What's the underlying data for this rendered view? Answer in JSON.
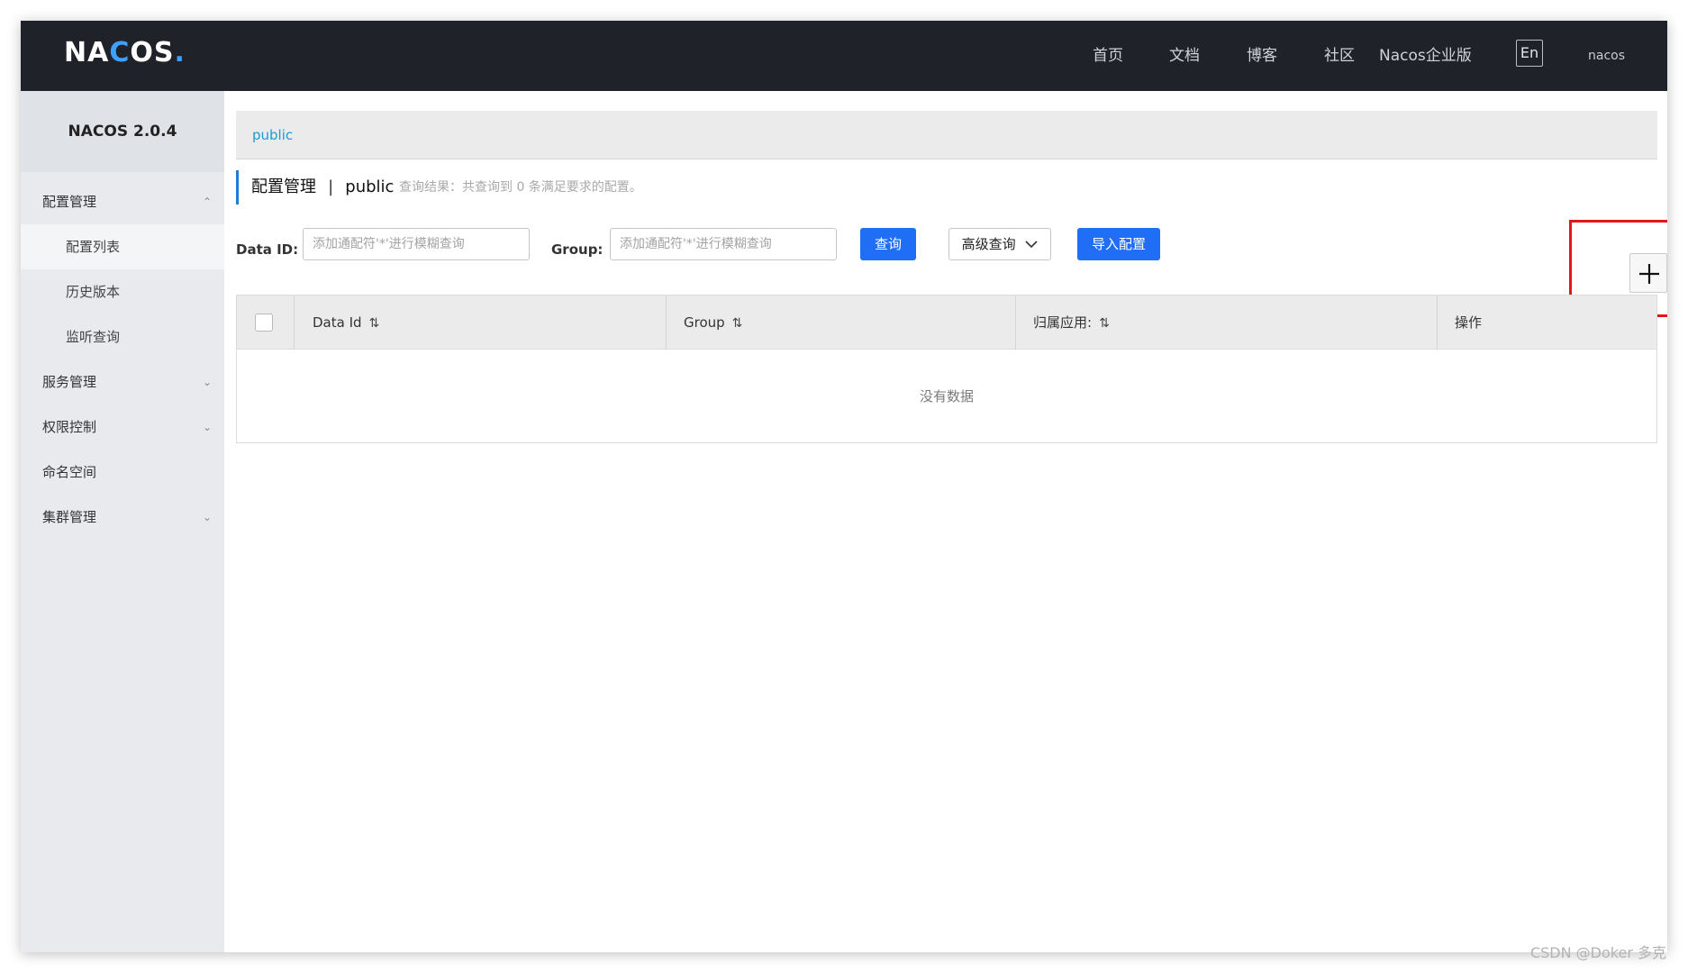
{
  "header": {
    "logo_text": "NACOS.",
    "nav": [
      "首页",
      "文档",
      "博客",
      "社区",
      "Nacos企业版"
    ],
    "lang_button": "En",
    "user": "nacos"
  },
  "sidebar": {
    "version": "NACOS 2.0.4",
    "items": [
      {
        "label": "配置管理",
        "expanded": true
      },
      {
        "label": "配置列表",
        "active": true
      },
      {
        "label": "历史版本"
      },
      {
        "label": "监听查询"
      },
      {
        "label": "服务管理",
        "expanded": false
      },
      {
        "label": "权限控制",
        "expanded": false
      },
      {
        "label": "命名空间"
      },
      {
        "label": "集群管理",
        "expanded": false
      }
    ]
  },
  "main": {
    "namespace_tab": "public",
    "title": "配置管理",
    "title_separator": "|",
    "title_namespace": "public",
    "result_text": "查询结果：共查询到 0 条满足要求的配置。",
    "filters": {
      "data_id_label": "Data ID:",
      "data_id_placeholder": "添加通配符'*'进行模糊查询",
      "group_label": "Group:",
      "group_placeholder": "添加通配符'*'进行模糊查询",
      "search_button": "查询",
      "advanced_button": "高级查询",
      "import_button": "导入配置"
    },
    "table": {
      "columns": [
        "Data Id",
        "Group",
        "归属应用:",
        "操作"
      ],
      "empty_text": "没有数据"
    }
  },
  "watermark": "CSDN @Doker 多克",
  "colors": {
    "topbar": "#1f2329",
    "primary": "#1f6ef5",
    "link": "#1a9cd2",
    "highlight": "#e0181b"
  }
}
